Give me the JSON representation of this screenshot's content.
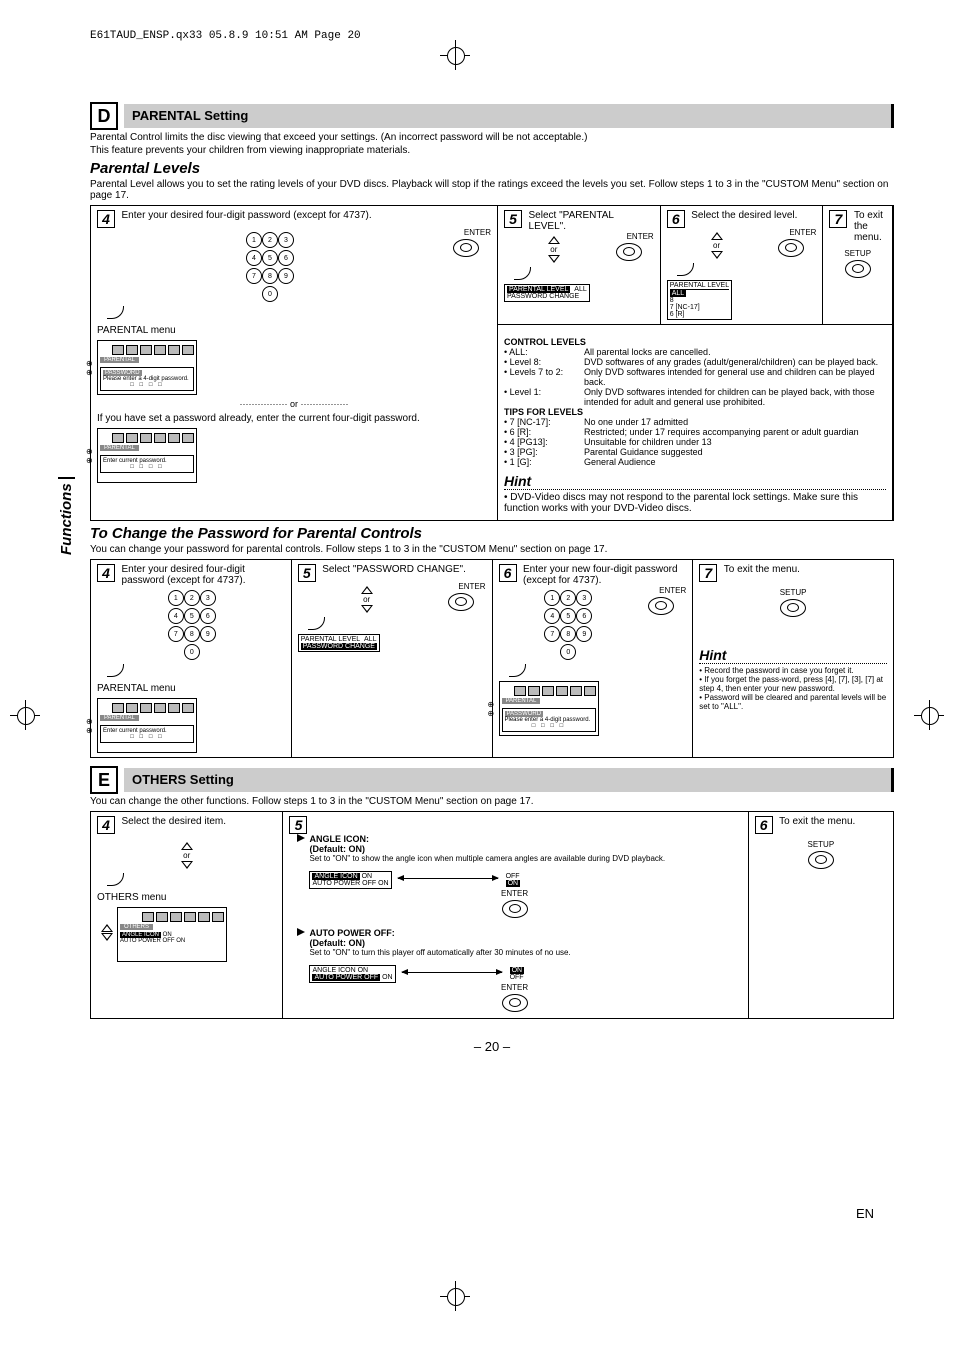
{
  "header_line": "E61TAUD_ENSP.qx33  05.8.9  10:51 AM  Page 20",
  "side_tab": "Functions",
  "sectionD": {
    "letter": "D",
    "title": "PARENTAL Setting",
    "intro1": "Parental Control limits the disc viewing that exceed your settings. (An incorrect password will be not acceptable.)",
    "intro2": "This feature prevents your children from viewing inappropriate materials.",
    "parental_levels_heading": "Parental Levels",
    "parental_levels_desc": "Parental Level allows you to set the rating levels of your DVD discs. Playback will stop if the ratings exceed the levels you set. Follow steps 1 to 3 in the \"CUSTOM Menu\" section on page 17.",
    "step4": {
      "num": "4",
      "text": "Enter your desired four-digit password (except for 4737).",
      "menu_label": "PARENTAL menu",
      "or_text": "If you have set a password already, enter the current four-digit password.",
      "screen_enter_msg": "Please enter a 4-digit password.",
      "screen_current_msg": "Enter current password.",
      "enter": "ENTER"
    },
    "step5": {
      "num": "5",
      "text": "Select \"PARENTAL LEVEL\".",
      "menu_items": [
        "PARENTAL LEVEL",
        "PASSWORD CHANGE"
      ],
      "menu_value": "ALL",
      "enter": "ENTER",
      "or": "or"
    },
    "step6": {
      "num": "6",
      "text": "Select the desired level.",
      "menu_title": "PARENTAL LEVEL",
      "options": [
        "ALL",
        "8",
        "7 [NC-17]",
        "6 [R]"
      ],
      "enter": "ENTER",
      "or": "or"
    },
    "step7": {
      "num": "7",
      "text": "To exit the menu.",
      "setup": "SETUP"
    },
    "control_levels": {
      "heading": "CONTROL LEVELS",
      "rows": [
        [
          "• ALL:",
          "All parental locks are cancelled."
        ],
        [
          "• Level 8:",
          "DVD softwares of any grades (adult/general/children) can be played back."
        ],
        [
          "• Levels 7 to 2:",
          "Only DVD softwares intended for general use and children can be played back."
        ],
        [
          "• Level 1:",
          "Only DVD softwares intended for children can be played back, with those intended for adult and general use prohibited."
        ]
      ],
      "tips_heading": "TIPS FOR LEVELS",
      "tips": [
        [
          "• 7 [NC-17]:",
          "No one under 17 admitted"
        ],
        [
          "• 6 [R]:",
          "Restricted; under 17 requires accompanying parent or adult guardian"
        ],
        [
          "• 4 [PG13]:",
          "Unsuitable for children under 13"
        ],
        [
          "• 3 [PG]:",
          "Parental Guidance suggested"
        ],
        [
          "• 1 [G]:",
          "General Audience"
        ]
      ]
    },
    "hint1": {
      "label": "Hint",
      "text": "• DVD-Video discs may not respond to the parental lock settings. Make sure this function works with your DVD-Video discs."
    },
    "change_pw_heading": "To Change the Password for Parental Controls",
    "change_pw_desc": "You can change your password for parental controls. Follow steps 1 to 3 in the \"CUSTOM Menu\" section on page 17.",
    "pw_step4": {
      "num": "4",
      "text": "Enter your desired four-digit password (except for 4737).",
      "menu_label": "PARENTAL menu",
      "screen_current_msg": "Enter current password."
    },
    "pw_step5": {
      "num": "5",
      "text": "Select \"PASSWORD CHANGE\".",
      "menu_items": [
        "PARENTAL LEVEL",
        "PASSWORD CHANGE"
      ],
      "menu_value": "ALL",
      "enter": "ENTER",
      "or": "or"
    },
    "pw_step6": {
      "num": "6",
      "text": "Enter your new four-digit password (except for 4737).",
      "enter": "ENTER",
      "screen_msg": "Please enter a 4-digit password."
    },
    "pw_step7": {
      "num": "7",
      "text": "To exit the menu.",
      "setup": "SETUP"
    },
    "hint2": {
      "label": "Hint",
      "lines": [
        "• Record the password in case you forget it.",
        "• If you forget the pass-word, press [4], [7], [3], [7] at step 4, then enter your new password.",
        "• Password will be cleared and parental levels will be set to \"ALL\"."
      ]
    }
  },
  "sectionE": {
    "letter": "E",
    "title": "OTHERS Setting",
    "intro": "You can change the other functions. Follow steps 1 to 3 in the \"CUSTOM Menu\" section on page 17.",
    "step4": {
      "num": "4",
      "text": "Select the desired item.",
      "menu_label": "OTHERS menu",
      "or": "or"
    },
    "step5": {
      "num": "5",
      "angle_icon": {
        "title": "ANGLE ICON:",
        "default": "(Default: ON)",
        "desc": "Set to \"ON\" to show the angle icon when multiple camera angles are available during DVD playback.",
        "menu": [
          "ANGLE ICON",
          "AUTO POWER OFF"
        ],
        "values_left": [
          "ON",
          "ON"
        ],
        "values_right": [
          "OFF",
          "ON"
        ],
        "enter": "ENTER"
      },
      "auto_power": {
        "title": "AUTO POWER OFF:",
        "default": "(Default: ON)",
        "desc": "Set to \"ON\" to turn this player off automatically after 30 minutes of no use.",
        "menu": [
          "ANGLE ICON",
          "AUTO POWER OFF"
        ],
        "values_left": [
          "ON",
          "ON"
        ],
        "values_right": [
          "ON",
          "OFF"
        ],
        "enter": "ENTER"
      }
    },
    "step6": {
      "num": "6",
      "text": "To exit the menu.",
      "setup": "SETUP"
    }
  },
  "page_number": "20",
  "page_lang": "EN"
}
